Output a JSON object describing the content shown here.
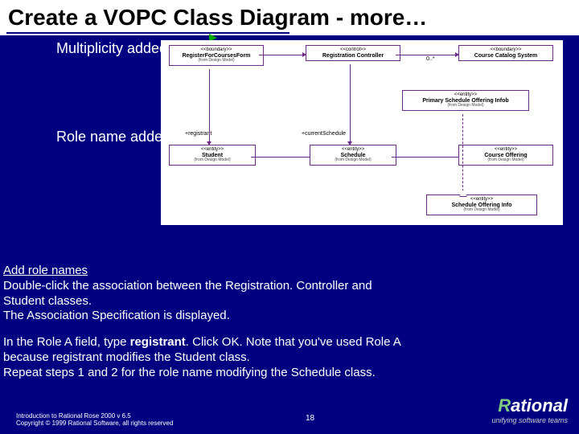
{
  "title": "Create a VOPC Class Diagram  - more…",
  "annot": {
    "multiplicity": "Multiplicity added",
    "rolename": "Role name added"
  },
  "diagram": {
    "boxes": {
      "form": {
        "stereo": "<<boundary>>",
        "name": "RegisterForCoursesForm",
        "from": "(from Design Model)"
      },
      "ctrl": {
        "stereo": "<<control>>",
        "name": "Registration Controller",
        "from": ""
      },
      "catalog": {
        "stereo": "<<boundary>>",
        "name": "Course Catalog System",
        "from": ""
      },
      "primary": {
        "stereo": "<<entity>>",
        "name": "Primary Schedule Offering Infob",
        "from": "(from Design Model)"
      },
      "student": {
        "stereo": "<<entity>>",
        "name": "Student",
        "from": "(from Design Model)"
      },
      "schedule": {
        "stereo": "<<entity>>",
        "name": "Schedule",
        "from": "(from Design Model)"
      },
      "offering": {
        "stereo": "<<entity>>",
        "name": "Course Offering",
        "from": "(from Design Model)"
      },
      "schedinfo": {
        "stereo": "<<entity>>",
        "name": "Schedule Offering Info",
        "from": "(from Design Model)"
      }
    },
    "labels": {
      "mult": "0..*",
      "registrant": "+registrant",
      "currentSchedule": "+currentSchedule"
    }
  },
  "instructions": {
    "h1": "Add role names",
    "p1a": "Double-click the association between the Registration. Controller and",
    "p1b": " Student classes.",
    "p2": "The Association Specification is displayed.",
    "p3a": "In the Role A field, type ",
    "p3b": "registrant",
    "p3c": ". Click OK. Note that you've used Role A",
    "p4": " because registrant modifies the Student class.",
    "p5": "Repeat steps 1 and 2 for the role name modifying the Schedule class."
  },
  "footer": {
    "f1": "Introduction to Rational Rose 2000 v 6.5",
    "f2": "Copyright © 1999 Rational Software, all rights reserved"
  },
  "slide": "18",
  "logo": {
    "brand_r": "R",
    "brand_rest": "ational",
    "tag": "unifying software teams"
  }
}
